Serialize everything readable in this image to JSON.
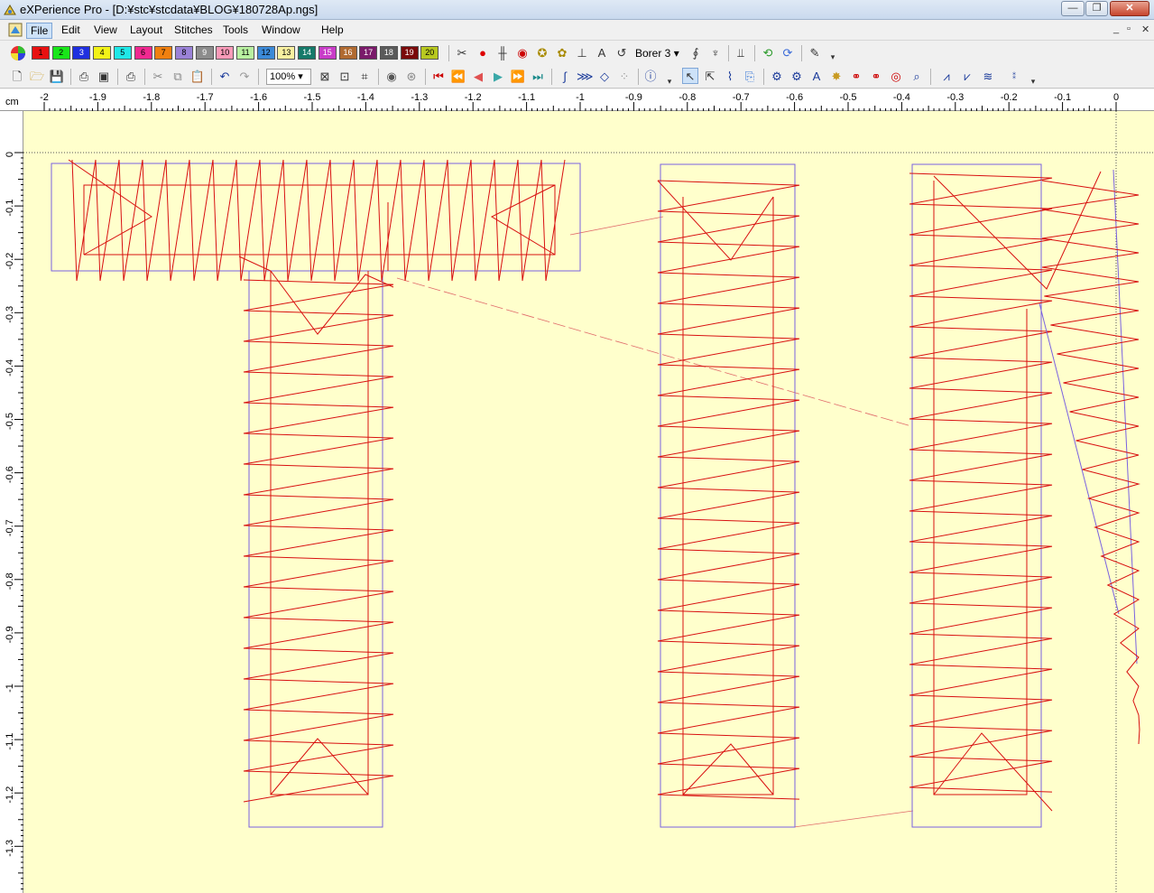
{
  "window": {
    "title": "eXPerience Pro - [D:¥stc¥stcdata¥BLOG¥180728Ap.ngs]",
    "min": "—",
    "max": "❐",
    "close": "✕"
  },
  "menu": {
    "items": [
      "File",
      "Edit",
      "View",
      "Layout",
      "Stitches",
      "Tools",
      "Window",
      "Help"
    ],
    "mdi_min": "_",
    "mdi_restore": "▫",
    "mdi_close": "✕"
  },
  "palette": {
    "swatches": [
      {
        "label": "1",
        "color": "#e81010"
      },
      {
        "label": "2",
        "color": "#19e619"
      },
      {
        "label": "3",
        "color": "#1f2fe0"
      },
      {
        "label": "4",
        "color": "#f2f218"
      },
      {
        "label": "5",
        "color": "#20e8e8"
      },
      {
        "label": "6",
        "color": "#f02890"
      },
      {
        "label": "7",
        "color": "#f08010"
      },
      {
        "label": "8",
        "color": "#9a82d8"
      },
      {
        "label": "9",
        "color": "#8c8c8c"
      },
      {
        "label": "10",
        "color": "#f89ab8"
      },
      {
        "label": "11",
        "color": "#b8f0a0"
      },
      {
        "label": "12",
        "color": "#3c8ad8"
      },
      {
        "label": "13",
        "color": "#f8f0a0"
      },
      {
        "label": "14",
        "color": "#157a6a"
      },
      {
        "label": "15",
        "color": "#c83cc8"
      },
      {
        "label": "16",
        "color": "#b06a30"
      },
      {
        "label": "17",
        "color": "#7a1a6a"
      },
      {
        "label": "18",
        "color": "#5a5a5a"
      },
      {
        "label": "19",
        "color": "#7a0a0a"
      },
      {
        "label": "20",
        "color": "#b8c820"
      }
    ]
  },
  "toolbar": {
    "borer": "Borer 3",
    "zoom": "100%"
  },
  "ruler": {
    "unit": "cm",
    "h_labels": [
      "-2",
      "-1.9",
      "-1.8",
      "-1.7",
      "-1.6",
      "-1.5",
      "-1.4",
      "-1.3",
      "-1.2",
      "-1.1",
      "-1",
      "-0.9",
      "-0.8",
      "-0.7",
      "-0.6",
      "-0.5",
      "-0.4",
      "-0.3",
      "-0.2",
      "-0.1",
      "0"
    ],
    "v_labels": [
      "0",
      "-0.1",
      "-0.2",
      "-0.3",
      "-0.4",
      "-0.5",
      "-0.6",
      "-0.7",
      "-0.8",
      "-0.9",
      "-1",
      "-1.1",
      "-1.2",
      "-1.3"
    ]
  },
  "design": {
    "stitch_color": "#d81010",
    "outline_color": "#7a62e0",
    "travel_color": "#e06a6a",
    "guide_color": "#555555"
  }
}
